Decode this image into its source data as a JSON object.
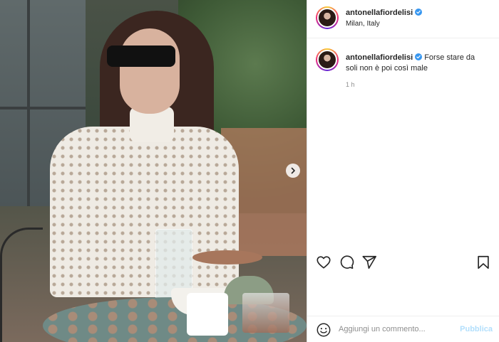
{
  "post": {
    "username": "antonellafiordelisi",
    "verified": true,
    "location": "Milan, Italy",
    "caption": "Forse stare da soli non è poi così male",
    "time_ago": "1 h",
    "photo_alt": "",
    "colors": {
      "verified_badge": "#3897f0",
      "publish_disabled": "#b2dffc",
      "muted_text": "#8e8e8e"
    }
  },
  "icons": {
    "next": "chevron-right-icon",
    "like": "heart-icon",
    "comment": "comment-icon",
    "share": "paper-plane-icon",
    "save": "bookmark-icon",
    "emoji": "smiley-icon"
  },
  "comment_box": {
    "placeholder": "Aggiungi un commento...",
    "publish_label": "Pubblica"
  }
}
